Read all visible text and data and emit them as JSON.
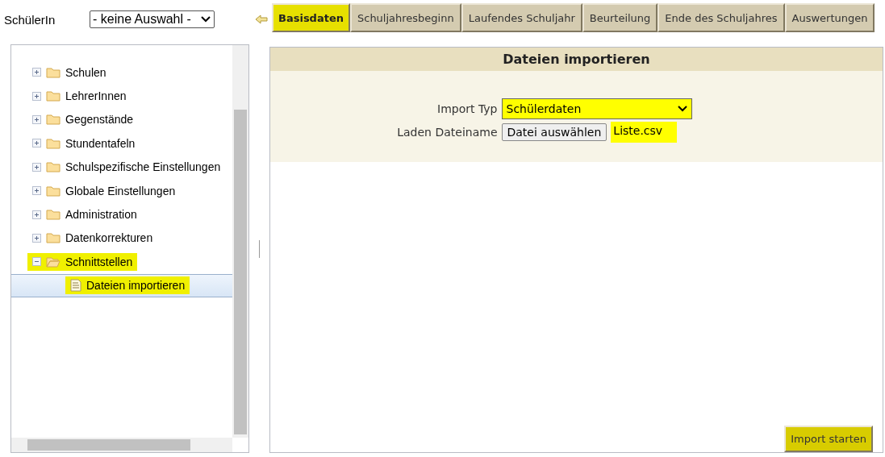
{
  "student_selector": {
    "label": "SchülerIn",
    "value": "- keine Auswahl -"
  },
  "tabs": [
    {
      "label": "Basisdaten",
      "selected": true
    },
    {
      "label": "Schuljahresbeginn",
      "selected": false
    },
    {
      "label": "Laufendes Schuljahr",
      "selected": false
    },
    {
      "label": "Beurteilung",
      "selected": false
    },
    {
      "label": "Ende des Schuljahres",
      "selected": false
    },
    {
      "label": "Auswertungen",
      "selected": false
    }
  ],
  "tree": [
    {
      "label": "Schulen",
      "expanded": false,
      "highlighted": false
    },
    {
      "label": "LehrerInnen",
      "expanded": false,
      "highlighted": false
    },
    {
      "label": "Gegenstände",
      "expanded": false,
      "highlighted": false
    },
    {
      "label": "Stundentafeln",
      "expanded": false,
      "highlighted": false
    },
    {
      "label": "Schulspezifische Einstellungen",
      "expanded": false,
      "highlighted": false
    },
    {
      "label": "Globale Einstellungen",
      "expanded": false,
      "highlighted": false
    },
    {
      "label": "Administration",
      "expanded": false,
      "highlighted": false
    },
    {
      "label": "Datenkorrekturen",
      "expanded": false,
      "highlighted": false
    },
    {
      "label": "Schnittstellen",
      "expanded": true,
      "highlighted": true,
      "children": [
        {
          "label": "Dateien importieren",
          "selected": true,
          "highlighted": true
        }
      ]
    }
  ],
  "panel": {
    "title": "Dateien importieren",
    "import_type": {
      "label": "Import Typ",
      "value": "Schülerdaten",
      "highlighted": true
    },
    "file": {
      "label": "Laden Dateiname",
      "button": "Datei auswählen",
      "file_name": "Liste.csv",
      "highlighted": true
    },
    "start_button": {
      "label": "Import starten",
      "highlighted": true
    }
  }
}
